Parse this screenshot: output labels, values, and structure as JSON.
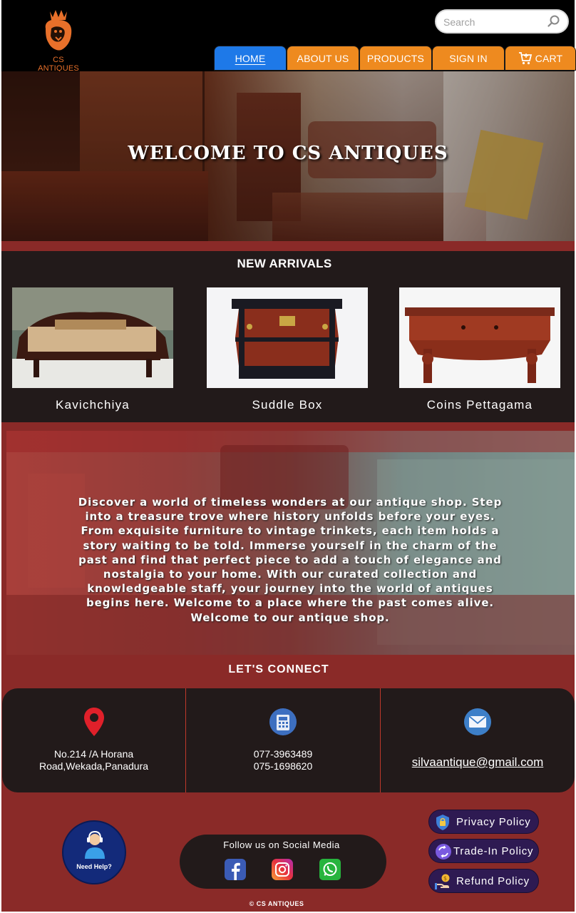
{
  "header": {
    "logo_text": "CS ANTIQUES",
    "search": {
      "placeholder": "Search"
    },
    "nav": [
      {
        "label": "HOME",
        "active": true
      },
      {
        "label": "ABOUT US",
        "active": false
      },
      {
        "label": "PRODUCTS",
        "active": false
      },
      {
        "label": "SIGN IN",
        "active": false
      },
      {
        "label": "CART",
        "active": false
      }
    ],
    "colors": {
      "nav_active": "#1e79e8",
      "nav": "#ee8a1f",
      "logo": "#e8702a"
    }
  },
  "hero": {
    "title": "WELCOME TO CS ANTIQUES"
  },
  "new_arrivals": {
    "heading": "NEW ARRIVALS",
    "items": [
      {
        "name": "Kavichchiya"
      },
      {
        "name": "Suddle Box"
      },
      {
        "name": "Coins Pettagama"
      }
    ]
  },
  "about": {
    "text": "Discover a world of timeless wonders at our antique shop. Step into a treasure trove where history unfolds before your eyes. From exquisite furniture to vintage trinkets, each item holds a story waiting to be told. Immerse yourself in the charm of the past and find that perfect piece to add a touch of elegance and nostalgia to your home. With our curated collection and knowledgeable staff, your journey into the world of antiques begins here. Welcome to a place where the past comes alive. Welcome to our antique shop."
  },
  "connect": {
    "heading": "LET'S CONNECT",
    "address_line1": "No.214 /A Horana",
    "address_line2": "Road,Wekada,Panadura",
    "phone1": "077-3963489",
    "phone2": "075-1698620",
    "email": "silvaantique@gmail.com"
  },
  "footer": {
    "help_label": "Need Help?",
    "social_title": "Follow us on Social Media",
    "policies": [
      "Privacy Policy",
      "Trade-In Policy",
      "Refund Policy"
    ],
    "copyright": "© CS ANTIQUES",
    "colors": {
      "background": "#8a2a28",
      "panel": "#221a1a",
      "policy": "#2e1a52"
    }
  }
}
